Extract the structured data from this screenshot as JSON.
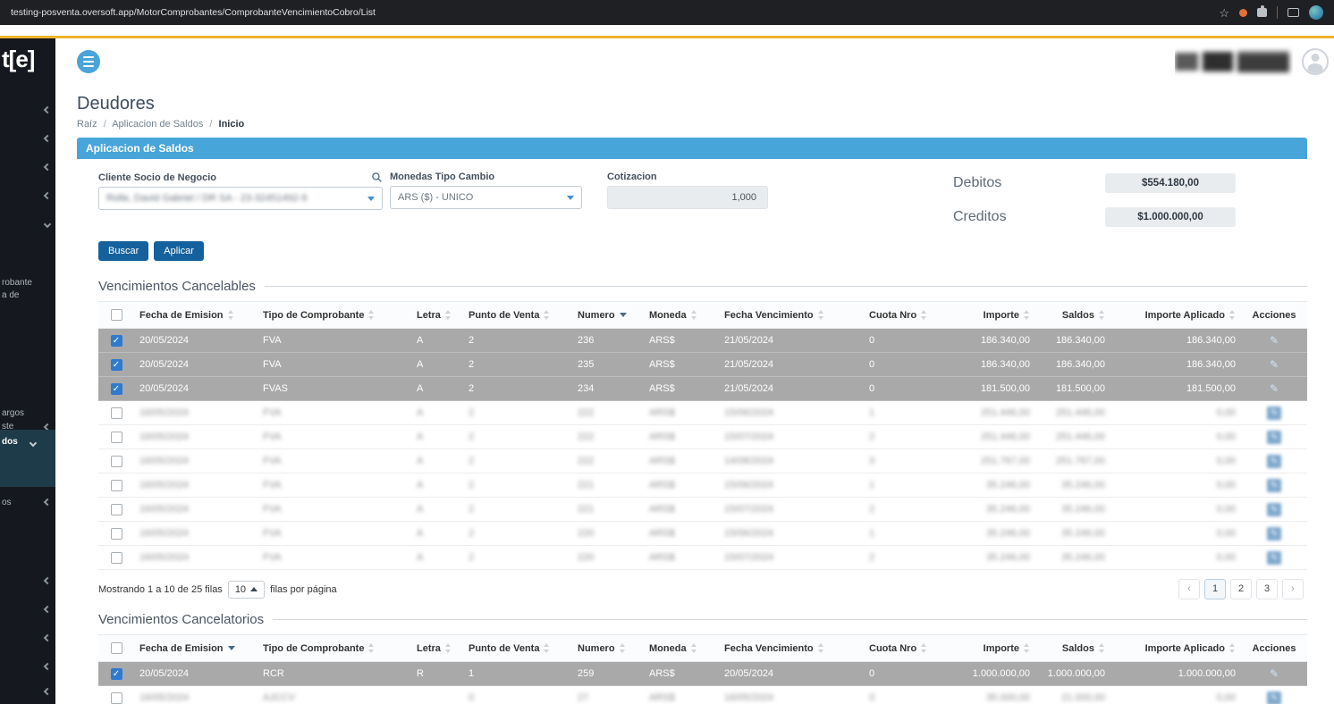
{
  "browser": {
    "url": "testing-posventa.oversoft.app/MotorComprobantes/ComprobanteVencimientoCobro/List"
  },
  "icons": {
    "star": "☆",
    "check": "✓",
    "edit": "✎"
  },
  "sidebar": {
    "logo_fragment": "t[e]",
    "partial_labels": {
      "l1": "robante",
      "l2": "a de",
      "l3": "argos",
      "l4": "ste",
      "l5": "dos",
      "l6": "os"
    }
  },
  "page": {
    "title": "Deudores",
    "breadcrumb": {
      "root": "Raíz",
      "section": "Aplicacion de Saldos",
      "current": "Inicio",
      "separator": "/"
    },
    "panel_title": "Aplicacion de Saldos"
  },
  "form": {
    "cliente": {
      "label": "Cliente Socio de Negocio",
      "value": "Rolle, David Gabriel / DR SA - 23-32451492-9",
      "blurred": true
    },
    "monedas": {
      "label": "Monedas Tipo Cambio",
      "value": "ARS ($) - UNICO"
    },
    "cotizacion": {
      "label": "Cotizacion",
      "value": "1,000"
    },
    "debitos": {
      "label": "Debitos",
      "value": "$554.180,00"
    },
    "creditos": {
      "label": "Creditos",
      "value": "$1.000.000,00"
    },
    "buttons": {
      "buscar": "Buscar",
      "aplicar": "Aplicar"
    }
  },
  "tables": {
    "columns": [
      {
        "label": "Fecha de Emision",
        "align": "left"
      },
      {
        "label": "Tipo de Comprobante",
        "align": "left"
      },
      {
        "label": "Letra",
        "align": "left"
      },
      {
        "label": "Punto de Venta",
        "align": "left"
      },
      {
        "label": "Numero",
        "align": "left"
      },
      {
        "label": "Moneda",
        "align": "left"
      },
      {
        "label": "Fecha Vencimiento",
        "align": "left"
      },
      {
        "label": "Cuota Nro",
        "align": "left"
      },
      {
        "label": "Importe",
        "align": "right"
      },
      {
        "label": "Saldos",
        "align": "right"
      },
      {
        "label": "Importe Aplicado",
        "align": "right"
      },
      {
        "label": "Acciones",
        "align": "center"
      }
    ],
    "cancelables": {
      "title": "Vencimientos Cancelables",
      "sort_column": "Numero",
      "rows": [
        {
          "checked": true,
          "selected": true,
          "blurred": false,
          "cells": [
            "20/05/2024",
            "FVA",
            "A",
            "2",
            "236",
            "ARS$",
            "21/05/2024",
            "0",
            "186.340,00",
            "186.340,00",
            "186.340,00"
          ]
        },
        {
          "checked": true,
          "selected": true,
          "blurred": false,
          "cells": [
            "20/05/2024",
            "FVA",
            "A",
            "2",
            "235",
            "ARS$",
            "21/05/2024",
            "0",
            "186.340,00",
            "186.340,00",
            "186.340,00"
          ]
        },
        {
          "checked": true,
          "selected": true,
          "blurred": false,
          "cells": [
            "20/05/2024",
            "FVAS",
            "A",
            "2",
            "234",
            "ARS$",
            "21/05/2024",
            "0",
            "181.500,00",
            "181.500,00",
            "181.500,00"
          ]
        },
        {
          "checked": false,
          "selected": false,
          "blurred": true,
          "cells": [
            "16/05/2024",
            "FVA",
            "A",
            "2",
            "222",
            "ARS$",
            "15/06/2024",
            "1",
            "251.446,00",
            "251.446,00",
            "0,00"
          ]
        },
        {
          "checked": false,
          "selected": false,
          "blurred": true,
          "cells": [
            "16/05/2024",
            "FVA",
            "A",
            "2",
            "222",
            "ARS$",
            "15/07/2024",
            "2",
            "251.446,00",
            "251.446,00",
            "0,00"
          ]
        },
        {
          "checked": false,
          "selected": false,
          "blurred": true,
          "cells": [
            "16/05/2024",
            "FVA",
            "A",
            "2",
            "222",
            "ARS$",
            "14/08/2024",
            "3",
            "251.767,00",
            "251.767,00",
            "0,00"
          ]
        },
        {
          "checked": false,
          "selected": false,
          "blurred": true,
          "cells": [
            "16/05/2024",
            "FVA",
            "A",
            "2",
            "221",
            "ARS$",
            "15/06/2024",
            "1",
            "35.246,00",
            "35.246,00",
            "0,00"
          ]
        },
        {
          "checked": false,
          "selected": false,
          "blurred": true,
          "cells": [
            "16/05/2024",
            "FVA",
            "A",
            "2",
            "221",
            "ARS$",
            "15/07/2024",
            "2",
            "35.246,00",
            "35.246,00",
            "0,00"
          ]
        },
        {
          "checked": false,
          "selected": false,
          "blurred": true,
          "cells": [
            "16/05/2024",
            "FVA",
            "A",
            "2",
            "220",
            "ARS$",
            "15/06/2024",
            "1",
            "35.246,00",
            "35.246,00",
            "0,00"
          ]
        },
        {
          "checked": false,
          "selected": false,
          "blurred": true,
          "cells": [
            "16/05/2024",
            "FVA",
            "A",
            "2",
            "220",
            "ARS$",
            "15/07/2024",
            "2",
            "35.246,00",
            "35.246,00",
            "0,00"
          ]
        }
      ],
      "pagination": {
        "info": "Mostrando 1 a 10 de 25 filas",
        "per_page": "10",
        "suffix": "filas por página",
        "prev": "‹",
        "next": "›",
        "pages": [
          "1",
          "2",
          "3"
        ],
        "active_page": "1"
      }
    },
    "cancelatorios": {
      "title": "Vencimientos Cancelatorios",
      "sort_column": "Fecha de Emision",
      "rows": [
        {
          "checked": true,
          "selected": true,
          "blurred": false,
          "cells": [
            "20/05/2024",
            "RCR",
            "R",
            "1",
            "259",
            "ARS$",
            "20/05/2024",
            "0",
            "1.000.000,00",
            "1.000.000,00",
            "1.000.000,00"
          ]
        },
        {
          "checked": false,
          "selected": false,
          "blurred": true,
          "cells": [
            "16/05/2024",
            "AJCCV",
            "",
            "0",
            "27",
            "ARS$",
            "16/05/2024",
            "0",
            "35.000,00",
            "21.000,00",
            "0,00"
          ]
        }
      ]
    }
  }
}
